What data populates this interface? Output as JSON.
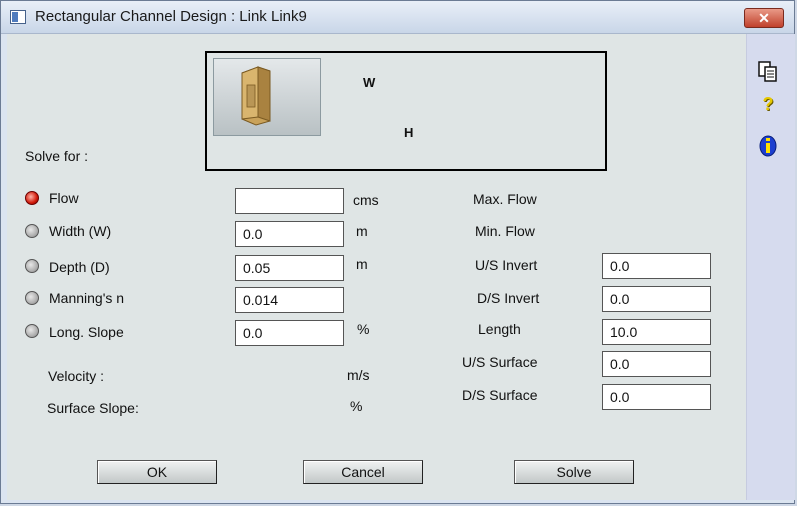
{
  "window": {
    "title": "Rectangular Channel Design : Link Link9",
    "close_glyph": "✕"
  },
  "diagram": {
    "width_label": "W",
    "height_label": "H"
  },
  "solve_for_label": "Solve for :",
  "params": [
    {
      "label": "Flow",
      "value": "",
      "unit": "cms",
      "selected": true
    },
    {
      "label": "Width (W)",
      "value": "0.0",
      "unit": "m",
      "selected": false
    },
    {
      "label": "Depth (D)",
      "value": "0.05",
      "unit": "m",
      "selected": false
    },
    {
      "label": "Manning's n",
      "value": "0.014",
      "unit": "",
      "selected": false
    },
    {
      "label": "Long. Slope",
      "value": "0.0",
      "unit": "%",
      "selected": false
    }
  ],
  "results": {
    "velocity_label": "Velocity :",
    "velocity_unit": "m/s",
    "surface_slope_label": "Surface Slope:",
    "surface_slope_unit": "%"
  },
  "right": {
    "max_flow_label": "Max. Flow",
    "min_flow_label": "Min. Flow",
    "fields": [
      {
        "label": "U/S Invert",
        "value": "0.0"
      },
      {
        "label": "D/S Invert",
        "value": "0.0"
      },
      {
        "label": "Length",
        "value": "10.0"
      },
      {
        "label": "U/S Surface",
        "value": "0.0"
      },
      {
        "label": "D/S Surface",
        "value": "0.0"
      }
    ]
  },
  "buttons": {
    "ok": "OK",
    "cancel": "Cancel",
    "solve": "Solve"
  },
  "toolbar": {
    "icons": [
      "copy-icon",
      "help-icon",
      "info-icon"
    ],
    "help_glyph": "?",
    "info_glyph": "i"
  }
}
